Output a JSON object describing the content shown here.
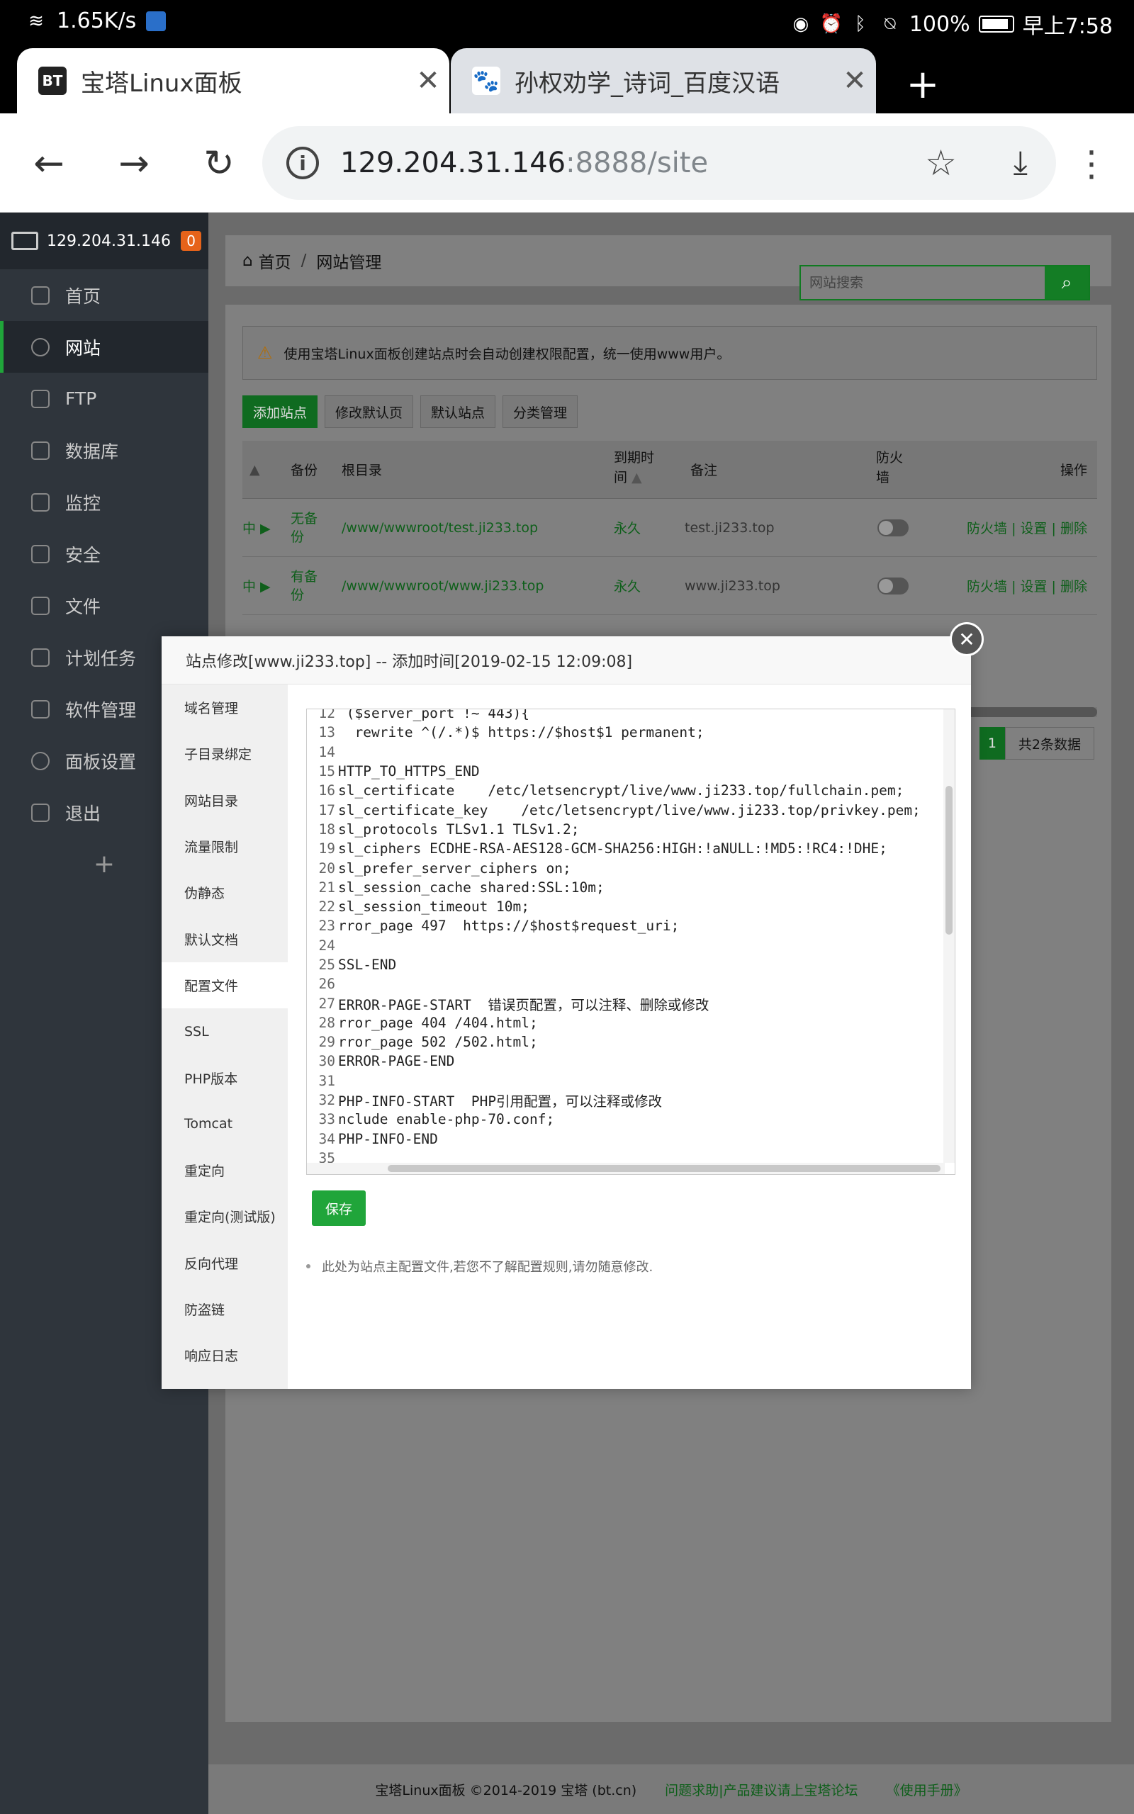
{
  "status_bar": {
    "net_speed": "1.65K/s",
    "battery": "100%",
    "time": "早上7:58"
  },
  "tabs": [
    {
      "favicon": "BT",
      "title": "宝塔Linux面板",
      "active": true
    },
    {
      "favicon": "du",
      "title": "孙权劝学_诗词_百度汉语",
      "active": false
    }
  ],
  "omnibox": {
    "host": "129.204.31.146",
    "path": ":8888/site"
  },
  "sidebar": {
    "server_ip": "129.204.31.146",
    "badge": "0",
    "items": [
      {
        "label": "首页",
        "icon": "home-icon"
      },
      {
        "label": "网站",
        "icon": "globe-icon",
        "active": true
      },
      {
        "label": "FTP",
        "icon": "ftp-icon"
      },
      {
        "label": "数据库",
        "icon": "database-icon"
      },
      {
        "label": "监控",
        "icon": "monitor-icon"
      },
      {
        "label": "安全",
        "icon": "shield-icon"
      },
      {
        "label": "文件",
        "icon": "folder-icon"
      },
      {
        "label": "计划任务",
        "icon": "calendar-icon"
      },
      {
        "label": "软件管理",
        "icon": "apps-icon"
      },
      {
        "label": "面板设置",
        "icon": "gear-icon"
      },
      {
        "label": "退出",
        "icon": "logout-icon"
      }
    ],
    "add": "+"
  },
  "breadcrumb": {
    "home": "首页",
    "sep": "/",
    "current": "网站管理"
  },
  "search": {
    "placeholder": "网站搜索"
  },
  "alert": "使用宝塔Linux面板创建站点时会自动创建权限配置，统一使用www用户。",
  "toolbar": [
    "添加站点",
    "修改默认页",
    "默认站点",
    "分类管理"
  ],
  "table": {
    "headers": {
      "backup": "备份",
      "root": "根目录",
      "expire_1": "到期时",
      "expire_2": "间",
      "remark": "备注",
      "firewall_1": "防火",
      "firewall_2": "墙",
      "ops": "操作"
    },
    "rows": [
      {
        "status": "中",
        "backup_1": "无备",
        "backup_2": "份",
        "root": "/www/wwwroot/test.ji233.top",
        "expire": "永久",
        "remark": "test.ji233.top",
        "ops": "防火墙 | 设置 | 删除"
      },
      {
        "status": "中",
        "backup_1": "有备",
        "backup_2": "份",
        "root": "/www/wwwroot/www.ji233.top",
        "expire": "永久",
        "remark": "www.ji233.top",
        "ops": "防火墙 | 设置 | 删除"
      }
    ]
  },
  "pager": {
    "page": "1",
    "total": "共2条数据"
  },
  "footer": {
    "copyright": "宝塔Linux面板 ©2014-2019 宝塔 (bt.cn)",
    "forum": "问题求助|产品建议请上宝塔论坛",
    "manual": "《使用手册》"
  },
  "modal": {
    "title": "站点修改[www.ji233.top] -- 添加时间[2019-02-15 12:09:08]",
    "nav": [
      "域名管理",
      "子目录绑定",
      "网站目录",
      "流量限制",
      "伪静态",
      "默认文档",
      "配置文件",
      "SSL",
      "PHP版本",
      "Tomcat",
      "重定向",
      "重定向(测试版)",
      "反向代理",
      "防盗链",
      "响应日志"
    ],
    "active_nav": "配置文件",
    "editor_lines": [
      {
        "n": "12",
        "t": " ($server_port !~ 443){"
      },
      {
        "n": "13",
        "t": "  rewrite ^(/.*)$ https://$host$1 permanent;"
      },
      {
        "n": "14",
        "t": ""
      },
      {
        "n": "15",
        "t": "HTTP_TO_HTTPS_END"
      },
      {
        "n": "16",
        "t": "sl_certificate    /etc/letsencrypt/live/www.ji233.top/fullchain.pem;"
      },
      {
        "n": "17",
        "t": "sl_certificate_key    /etc/letsencrypt/live/www.ji233.top/privkey.pem;"
      },
      {
        "n": "18",
        "t": "sl_protocols TLSv1.1 TLSv1.2;"
      },
      {
        "n": "19",
        "t": "sl_ciphers ECDHE-RSA-AES128-GCM-SHA256:HIGH:!aNULL:!MD5:!RC4:!DHE;"
      },
      {
        "n": "20",
        "t": "sl_prefer_server_ciphers on;"
      },
      {
        "n": "21",
        "t": "sl_session_cache shared:SSL:10m;"
      },
      {
        "n": "22",
        "t": "sl_session_timeout 10m;"
      },
      {
        "n": "23",
        "t": "rror_page 497  https://$host$request_uri;"
      },
      {
        "n": "24",
        "t": ""
      },
      {
        "n": "25",
        "t": "SSL-END"
      },
      {
        "n": "26",
        "t": ""
      },
      {
        "n": "27",
        "t": "ERROR-PAGE-START  错误页配置，可以注释、删除或修改"
      },
      {
        "n": "28",
        "t": "rror_page 404 /404.html;"
      },
      {
        "n": "29",
        "t": "rror_page 502 /502.html;"
      },
      {
        "n": "30",
        "t": "ERROR-PAGE-END"
      },
      {
        "n": "31",
        "t": ""
      },
      {
        "n": "32",
        "t": "PHP-INFO-START  PHP引用配置，可以注释或修改"
      },
      {
        "n": "33",
        "t": "nclude enable-php-70.conf;"
      },
      {
        "n": "34",
        "t": "PHP-INFO-END"
      },
      {
        "n": "35",
        "t": ""
      }
    ],
    "save": "保存",
    "tip": "此处为站点主配置文件,若您不了解配置规则,请勿随意修改."
  }
}
